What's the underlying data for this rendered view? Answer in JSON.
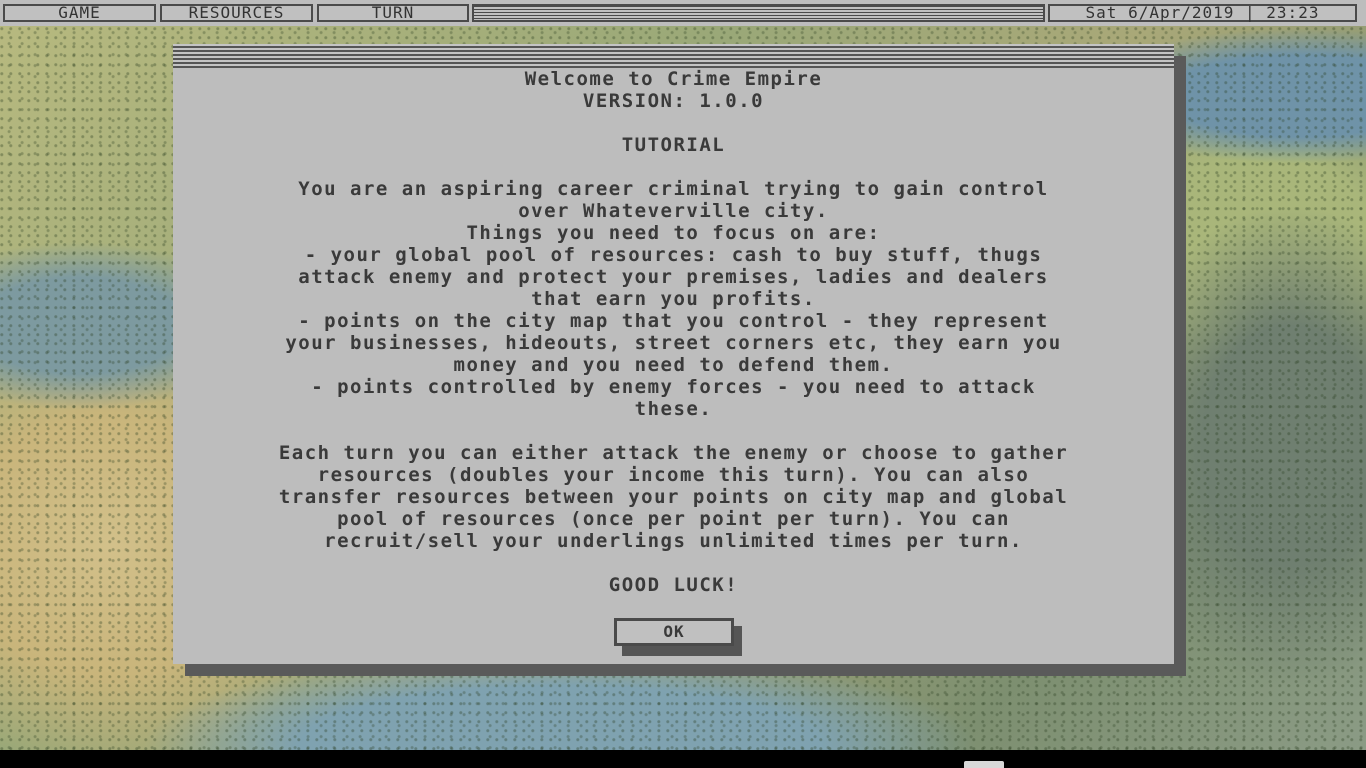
{
  "menubar": {
    "game_label": "GAME",
    "resources_label": "RESOURCES",
    "turn_label": "TURN",
    "clock": "Sat 6/Apr/2019 | 23:23"
  },
  "dialog": {
    "title": "Welcome to Crime Empire",
    "version": "VERSION: 1.0.0",
    "heading": "TUTORIAL",
    "intro_lines": [
      "You are an aspiring career criminal trying to gain control",
      "over Whateverville city.",
      "Things you need to focus on are:",
      "- your global pool of resources: cash to buy stuff, thugs",
      "attack enemy and protect your premises, ladies and dealers",
      "that earn you profits.",
      "- points on the city map that you control - they represent",
      "your businesses, hideouts, street corners etc, they earn you",
      "money and you need to defend them.",
      "- points controlled by enemy forces - you need to attack",
      "these."
    ],
    "turn_lines": [
      "Each turn you can either attack the enemy or choose to gather",
      "resources (doubles your income this turn). You can also",
      "transfer resources between your points on city map and global",
      "pool of resources (once per point per turn). You can",
      "recruit/sell your underlings unlimited times per turn."
    ],
    "closing": "GOOD LUCK!",
    "ok_label": "OK"
  }
}
